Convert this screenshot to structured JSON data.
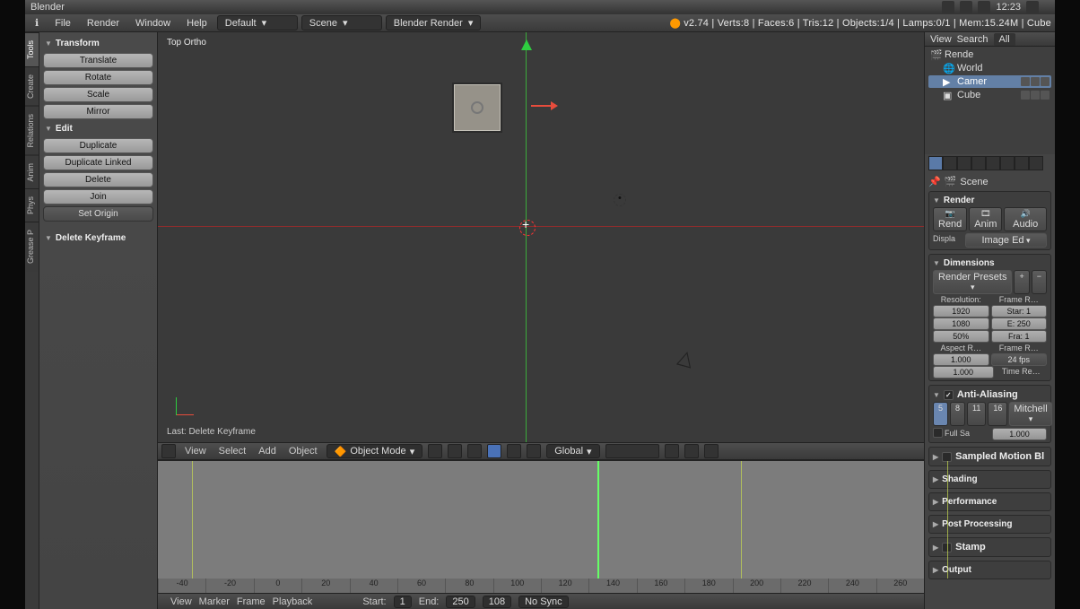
{
  "app_title": "Blender",
  "sys_time": "12:23",
  "menubar": {
    "file": "File",
    "render": "Render",
    "window": "Window",
    "help": "Help",
    "layout": "Default",
    "scene": "Scene",
    "engine": "Blender Render",
    "stats": "v2.74 | Verts:8 | Faces:6 | Tris:12 | Objects:1/4 | Lamps:0/1 | Mem:15.24M | Cube"
  },
  "left_tabs": [
    "Tools",
    "Create",
    "Relations",
    "Anim",
    "Phys",
    "Grease P"
  ],
  "toolshelf": {
    "transform_hd": "Transform",
    "translate": "Translate",
    "rotate": "Rotate",
    "scale": "Scale",
    "mirror": "Mirror",
    "edit_hd": "Edit",
    "duplicate": "Duplicate",
    "duplicate_linked": "Duplicate Linked",
    "delete": "Delete",
    "join": "Join",
    "set_origin": "Set Origin",
    "op_hd": "Delete Keyframe"
  },
  "viewport": {
    "label": "Top Ortho",
    "last_op": "Last: Delete Keyframe"
  },
  "vp_header": {
    "view": "View",
    "select": "Select",
    "add": "Add",
    "object": "Object",
    "mode": "Object Mode",
    "orient": "Global"
  },
  "dopesheet": {
    "ticks": [
      "-40",
      "-20",
      "0",
      "20",
      "40",
      "60",
      "80",
      "100",
      "120",
      "140",
      "160",
      "180",
      "200",
      "220",
      "240",
      "260"
    ],
    "header": {
      "view": "View",
      "marker": "Marker",
      "frame": "Frame",
      "playback": "Playback",
      "start_lbl": "Start:",
      "start": "1",
      "end_lbl": "End:",
      "end": "250",
      "cur": "108",
      "sync": "No Sync"
    }
  },
  "outliner": {
    "tabs": {
      "view": "View",
      "search": "Search",
      "all": "All"
    },
    "rows": [
      {
        "label": "Rende",
        "ico": "scene"
      },
      {
        "label": "World",
        "ico": "world",
        "indent": 1
      },
      {
        "label": "Camer",
        "ico": "camera",
        "indent": 1,
        "sel": true
      },
      {
        "label": "Cube",
        "ico": "mesh",
        "indent": 1
      }
    ]
  },
  "props": {
    "crumb": "Scene",
    "render_hd": "Render",
    "render_btn": "Rend",
    "anim_btn": "Anim",
    "audio_btn": "Audio",
    "display_lbl": "Displa",
    "display_val": "Image Ed",
    "dims_hd": "Dimensions",
    "presets": "Render Presets",
    "res_lbl": "Resolution:",
    "fr_lbl": "Frame R…",
    "res_x": "1920",
    "fr_start": "Star: 1",
    "res_y": "1080",
    "fr_end": "E: 250",
    "res_pct": "50%",
    "fr_step": "Fra:  1",
    "aspect_lbl": "Aspect R…",
    "fps_lbl": "Frame R…",
    "asp_x": "1.000",
    "fps": "24 fps",
    "asp_y": "1.000",
    "time_lbl": "Time Re…",
    "aa_hd": "Anti-Aliasing",
    "aa_samples": [
      "5",
      "8",
      "11",
      "16"
    ],
    "aa_filter": "Mitchell",
    "aa_full_lbl": "Full Sa",
    "aa_size": "1.000",
    "smb_hd": "Sampled Motion Bl",
    "shading_hd": "Shading",
    "perf_hd": "Performance",
    "post_hd": "Post Processing",
    "stamp_hd": "Stamp",
    "output_hd": "Output"
  }
}
